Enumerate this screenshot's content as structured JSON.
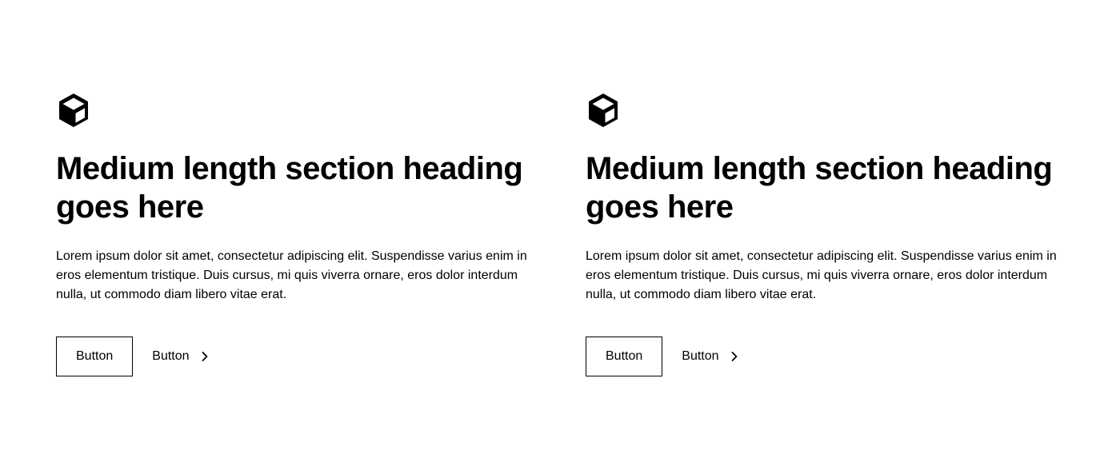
{
  "colors": {
    "text": "#000000",
    "background": "#ffffff",
    "border": "#000000"
  },
  "sections": [
    {
      "icon": "cube-icon",
      "heading": "Medium length section heading goes here",
      "body": "Lorem ipsum dolor sit amet, consectetur adipiscing elit. Suspendisse varius enim in eros elementum tristique. Duis cursus, mi quis viverra ornare, eros dolor interdum nulla, ut commodo diam libero vitae erat.",
      "primary_button": "Button",
      "secondary_button": "Button",
      "secondary_icon": "chevron-right-icon"
    },
    {
      "icon": "cube-icon",
      "heading": "Medium length section heading goes here",
      "body": "Lorem ipsum dolor sit amet, consectetur adipiscing elit. Suspendisse varius enim in eros elementum tristique. Duis cursus, mi quis viverra ornare, eros dolor interdum nulla, ut commodo diam libero vitae erat.",
      "primary_button": "Button",
      "secondary_button": "Button",
      "secondary_icon": "chevron-right-icon"
    }
  ]
}
